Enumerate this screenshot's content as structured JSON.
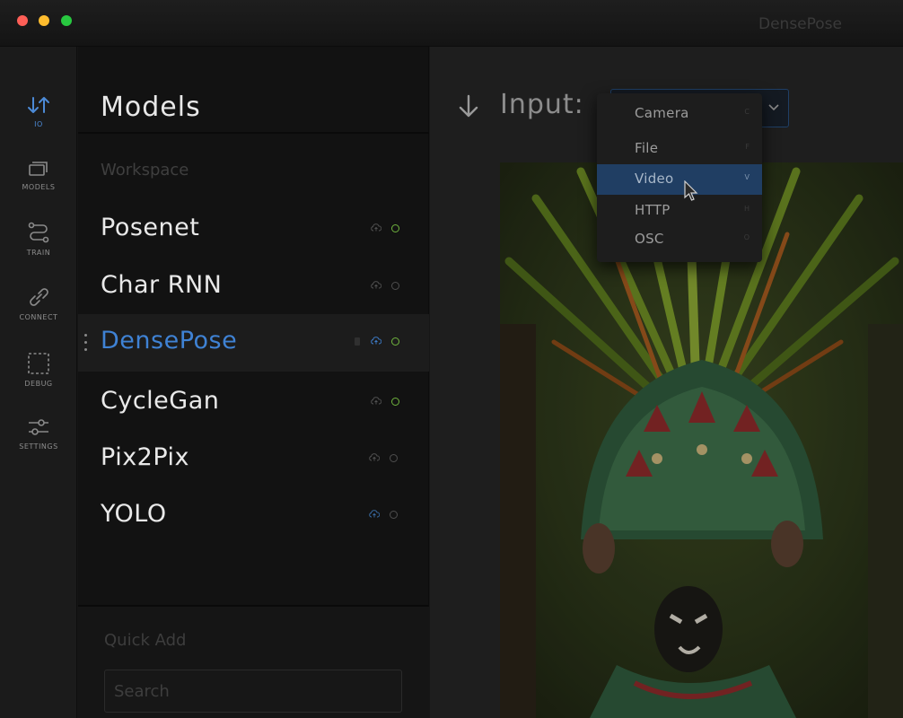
{
  "window": {
    "title": "DensePose"
  },
  "rail": {
    "items": [
      {
        "label": "IO",
        "icon": "io-arrows-icon",
        "active": true
      },
      {
        "label": "MODELS",
        "icon": "models-stack-icon"
      },
      {
        "label": "TRAIN",
        "icon": "train-path-icon"
      },
      {
        "label": "CONNECT",
        "icon": "link-icon"
      },
      {
        "label": "DEBUG",
        "icon": "dashed-square-icon"
      },
      {
        "label": "SETTINGS",
        "icon": "sliders-icon"
      }
    ]
  },
  "models_panel": {
    "title": "Models",
    "workspace_label": "Workspace",
    "models": [
      {
        "name": "Posenet",
        "status": "active"
      },
      {
        "name": "Char RNN",
        "status": "inactive"
      },
      {
        "name": "DensePose",
        "status": "active",
        "selected": true
      },
      {
        "name": "CycleGan",
        "status": "active"
      },
      {
        "name": "Pix2Pix",
        "status": "inactive"
      },
      {
        "name": "YOLO",
        "status": "inactive"
      }
    ],
    "quick_add_label": "Quick Add",
    "search_placeholder": "Search"
  },
  "main": {
    "input_label": "Input:",
    "input_options": [
      {
        "label": "Camera",
        "shortcut": "C"
      },
      {
        "label": "File",
        "shortcut": "F"
      },
      {
        "label": "Video",
        "shortcut": "V",
        "highlighted": true
      },
      {
        "label": "HTTP",
        "shortcut": "H"
      },
      {
        "label": "OSC",
        "shortcut": "O"
      }
    ]
  },
  "colors": {
    "accent": "#3f82d4",
    "status_active": "#6fb33e",
    "status_inactive": "#4e4e4e",
    "dropdown_highlight": "#203e63"
  }
}
